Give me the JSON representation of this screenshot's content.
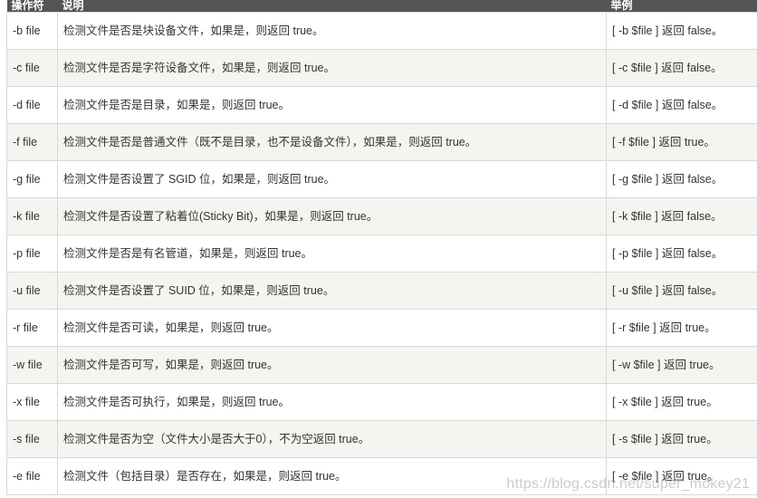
{
  "table": {
    "headers": [
      "操作符",
      "说明",
      "举例"
    ],
    "rows": [
      {
        "operator": "-b file",
        "description": "检测文件是否是块设备文件，如果是，则返回 true。",
        "example": "[ -b $file ] 返回 false。"
      },
      {
        "operator": "-c file",
        "description": "检测文件是否是字符设备文件，如果是，则返回 true。",
        "example": "[ -c $file ] 返回 false。"
      },
      {
        "operator": "-d file",
        "description": "检测文件是否是目录，如果是，则返回 true。",
        "example": "[ -d $file ] 返回 false。"
      },
      {
        "operator": "-f file",
        "description": "检测文件是否是普通文件（既不是目录，也不是设备文件），如果是，则返回 true。",
        "example": "[ -f $file ] 返回 true。"
      },
      {
        "operator": "-g file",
        "description": "检测文件是否设置了 SGID 位，如果是，则返回 true。",
        "example": "[ -g $file ] 返回 false。"
      },
      {
        "operator": "-k file",
        "description": "检测文件是否设置了粘着位(Sticky Bit)，如果是，则返回 true。",
        "example": "[ -k $file ] 返回 false。"
      },
      {
        "operator": "-p file",
        "description": "检测文件是否是有名管道，如果是，则返回 true。",
        "example": "[ -p $file ] 返回 false。"
      },
      {
        "operator": "-u file",
        "description": "检测文件是否设置了 SUID 位，如果是，则返回 true。",
        "example": "[ -u $file ] 返回 false。"
      },
      {
        "operator": "-r file",
        "description": "检测文件是否可读，如果是，则返回 true。",
        "example": "[ -r $file ] 返回 true。"
      },
      {
        "operator": "-w file",
        "description": "检测文件是否可写，如果是，则返回 true。",
        "example": "[ -w $file ] 返回 true。"
      },
      {
        "operator": "-x file",
        "description": "检测文件是否可执行，如果是，则返回 true。",
        "example": "[ -x $file ] 返回 true。"
      },
      {
        "operator": "-s file",
        "description": "检测文件是否为空（文件大小是否大于0），不为空返回 true。",
        "example": "[ -s $file ] 返回 true。"
      },
      {
        "operator": "-e file",
        "description": "检测文件（包括目录）是否存在，如果是，则返回 true。",
        "example": "[ -e $file ] 返回 true。"
      }
    ]
  },
  "watermark": "https://blog.csdn.net/super_mokey21",
  "colors": {
    "header_bg": "#555555",
    "header_text": "#ffffff",
    "row_alt_bg": "#f6f4f0",
    "border": "#d8d8d8",
    "text": "#333333"
  }
}
